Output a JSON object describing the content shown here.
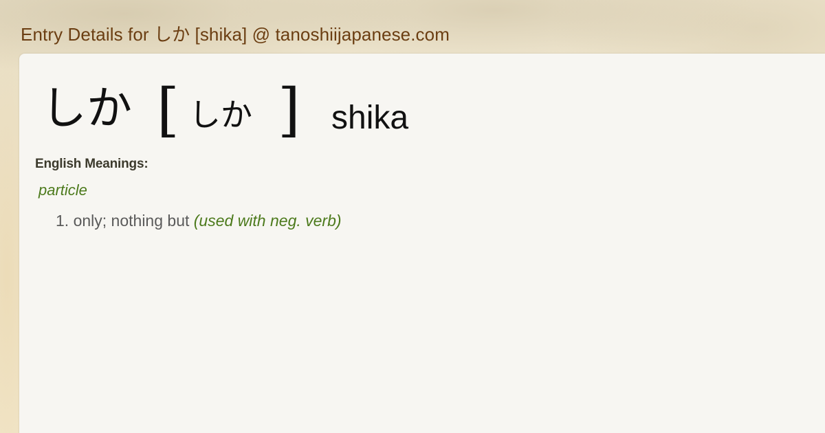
{
  "page": {
    "title": "Entry Details for しか [shika] @ tanoshiijapanese.com"
  },
  "entry": {
    "headword": "しか",
    "reading": "しか",
    "bracket_open": "[",
    "bracket_close": "]",
    "romaji": "shika"
  },
  "meanings": {
    "label": "English Meanings:",
    "part_of_speech": "particle",
    "senses": [
      {
        "number": "1.",
        "text": "only; nothing but",
        "note": "(used with neg. verb)"
      }
    ]
  },
  "colors": {
    "title": "#6b3e12",
    "part_of_speech": "#4c7a1c",
    "panel_bg": "#f7f6f2"
  }
}
